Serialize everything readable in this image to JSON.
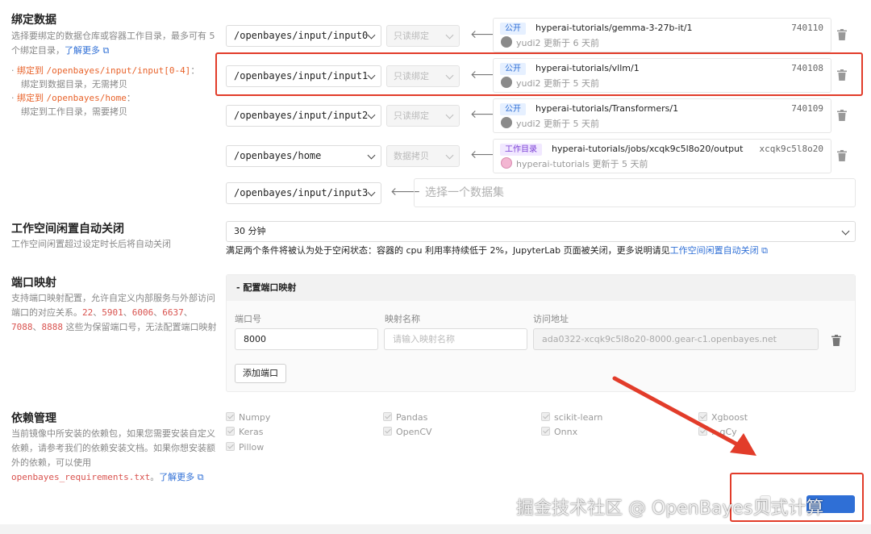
{
  "bind": {
    "title": "绑定数据",
    "desc": "选择要绑定的数据仓库或容器工作目录，最多可有 5 个绑定目录，",
    "learn_more": "了解更多",
    "bullets": [
      {
        "prefix": "绑定到",
        "path": "/openbayes/input/input[0-4]",
        "suffix": "：",
        "note": "绑定到数据目录，无需拷贝"
      },
      {
        "prefix": "绑定到",
        "path": "/openbayes/home",
        "suffix": "：",
        "note": "绑定到工作目录，需要拷贝"
      }
    ],
    "rows": [
      {
        "dir": "/openbayes/input/input0",
        "mode": "只读绑定",
        "badge": "公开",
        "name": "hyperai-tutorials/gemma-3-27b-it/1",
        "id": "740110",
        "user": "yudi2",
        "updated": "更新于 6 天前"
      },
      {
        "dir": "/openbayes/input/input1",
        "mode": "只读绑定",
        "badge": "公开",
        "name": "hyperai-tutorials/vllm/1",
        "id": "740108",
        "user": "yudi2",
        "updated": "更新于 5 天前"
      },
      {
        "dir": "/openbayes/input/input2",
        "mode": "只读绑定",
        "badge": "公开",
        "name": "hyperai-tutorials/Transformers/1",
        "id": "740109",
        "user": "yudi2",
        "updated": "更新于 5 天前"
      },
      {
        "dir": "/openbayes/home",
        "mode": "数据拷贝",
        "badge": "工作目录",
        "name": "hyperai-tutorials/jobs/xcqk9c5l8o20/output",
        "id": "xcqk9c5l8o20",
        "user": "hyperai-tutorials",
        "updated": "更新于 5 天前"
      }
    ],
    "empty_row": {
      "dir": "/openbayes/input/input3",
      "placeholder": "选择一个数据集"
    }
  },
  "idle": {
    "title": "工作空间闲置自动关闭",
    "desc": "工作空间闲置超过设定时长后将自动关闭",
    "value": "30 分钟",
    "note": "满足两个条件将被认为处于空闲状态：容器的 cpu 利用率持续低于 2%，JupyterLab 页面被关闭，更多说明请见",
    "note_link": "工作空间闲置自动关闭"
  },
  "port": {
    "title": "端口映射",
    "desc_a": "支持端口映射配置，允许自定义内部服务与外部访问端口的对应关系。",
    "reserved": [
      "22",
      "5901",
      "6006",
      "6637",
      "7088",
      "8888"
    ],
    "desc_b": "这些为保留端口号，无法配置端口映射",
    "panel_title": "- 配置端口映射",
    "col_port": "端口号",
    "col_name": "映射名称",
    "col_addr": "访问地址",
    "port_value": "8000",
    "name_placeholder": "请输入映射名称",
    "addr_value": "ada0322-xcqk9c5l8o20-8000.gear-c1.openbayes.net",
    "add_label": "添加端口"
  },
  "deps": {
    "title": "依赖管理",
    "desc": "当前镜像中所安装的依赖包，如果您需要安装自定义依赖，请参考我们的依赖安装文档。如果你想安装额外的依赖，可以使用",
    "req_file": "openbayes_requirements.txt",
    "learn_more": "了解更多",
    "packages": [
      "Numpy",
      "Pandas",
      "scikit-learn",
      "Xgboost",
      "Keras",
      "OpenCV",
      "Onnx",
      "...gCy",
      "Pillow"
    ]
  },
  "footer": {
    "watermark": "掘金技术社区 @ OpenBayes贝式计算"
  },
  "colors": {
    "accent": "#2f6fd6",
    "highlight_red": "#e23c2a",
    "path_orange": "#e8632b"
  }
}
